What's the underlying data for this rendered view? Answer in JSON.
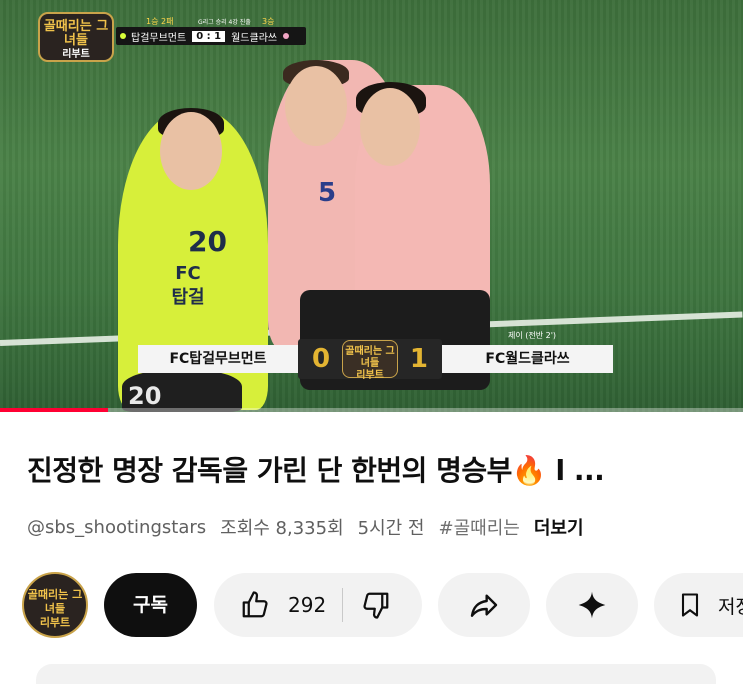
{
  "video": {
    "overlay": {
      "logo_text": "골때리는 그녀들",
      "logo_sub": "리부트",
      "record_left": "1승 2패",
      "record_mid": "G리그 승리 4강 진출",
      "record_right": "3승",
      "team_left": "탑걸무브먼트",
      "score": "0 : 1",
      "team_right": "월드클라쓰"
    },
    "lower_third": {
      "team_left": "FC탑걸무브먼트",
      "score_left": "0",
      "score_right": "1",
      "team_right": "FC월드클라쓰",
      "logo_text": "골때리는 그녀들",
      "logo_sub": "리부트",
      "time": "제이 (전반 2')"
    },
    "jersey": {
      "num_yellow": "20",
      "fc_text": "FC 탑걸",
      "num_pink": "5",
      "num_shorts": "20"
    },
    "progress_fraction": 0.145
  },
  "title": "진정한 명장 감독을 가린 단 한번의 명승부🔥 l ...",
  "meta": {
    "channel": "@sbs_shootingstars",
    "views": "조회수 8,335회",
    "age": "5시간 전",
    "hashtag": "#골때리는",
    "more": "더보기"
  },
  "actions": {
    "avatar_text": "골때리는 그녀들",
    "avatar_sub": "리부트",
    "subscribe": "구독",
    "likes": "292",
    "save_label": "저장"
  },
  "icons": [
    "thumbs-up-icon",
    "thumbs-down-icon",
    "share-icon",
    "sparkle-icon",
    "bookmark-icon"
  ],
  "colors": {
    "accent": "#ff0033",
    "text": "#0f0f0f",
    "secondary": "#606060",
    "pill": "#f2f2f2"
  }
}
